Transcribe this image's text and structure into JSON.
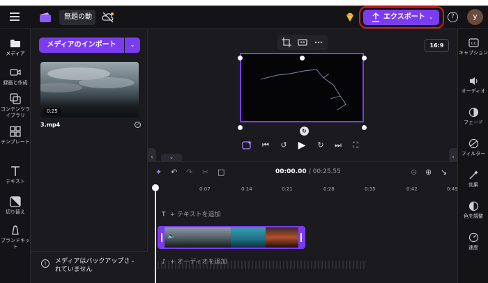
{
  "topbar": {
    "project_name": "無題の動",
    "export_label": "エクスポート",
    "help_label": "?",
    "avatar_initial": "y"
  },
  "left_rail": [
    {
      "id": "media",
      "label": "メディア"
    },
    {
      "id": "record",
      "label": "録画と作成"
    },
    {
      "id": "content",
      "label": "コンテンツライブラリ"
    },
    {
      "id": "templates",
      "label": "テンプレート"
    },
    {
      "id": "text",
      "label": "テキスト"
    },
    {
      "id": "transitions",
      "label": "切り替え"
    },
    {
      "id": "brandkit",
      "label": "ブランドキット"
    }
  ],
  "media_panel": {
    "import_label": "メディアのインポート",
    "asset": {
      "duration": "0:25",
      "filename": "3.mp4"
    },
    "backup_notice": "メディアはバックアップされていません"
  },
  "preview": {
    "aspect_ratio": "16:9"
  },
  "timeline": {
    "current_time": "00:00.00",
    "total_time": "/ 00:25.55",
    "ticks": [
      "0",
      "0:07",
      "0:14",
      "0:21",
      "0:28",
      "0:35",
      "0:42",
      "0:49"
    ],
    "text_track_label": "+ テキストを追加",
    "audio_track_label": "+ オーディオを追加"
  },
  "right_rail": [
    {
      "id": "captions",
      "label": "キャプション"
    },
    {
      "id": "audio",
      "label": "オーディオ"
    },
    {
      "id": "fade",
      "label": "フェード"
    },
    {
      "id": "filters",
      "label": "フィルター"
    },
    {
      "id": "effects",
      "label": "効果"
    },
    {
      "id": "color",
      "label": "色を調整"
    },
    {
      "id": "speed",
      "label": "速度"
    }
  ],
  "colors": {
    "accent": "#7b3cf0",
    "highlight_ring": "#e8141b",
    "background": "#1b1b1f"
  }
}
